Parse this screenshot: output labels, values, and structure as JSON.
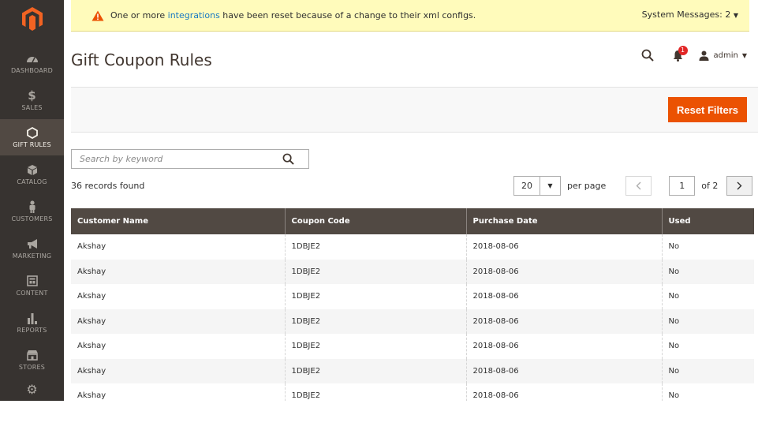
{
  "sidebar": {
    "items": [
      {
        "label": "DASHBOARD",
        "icon": "dashboard-icon",
        "active": false
      },
      {
        "label": "SALES",
        "icon": "dollar-icon",
        "active": false
      },
      {
        "label": "GIFT RULES",
        "icon": "hexagon-icon",
        "active": true
      },
      {
        "label": "CATALOG",
        "icon": "cube-icon",
        "active": false
      },
      {
        "label": "CUSTOMERS",
        "icon": "person-icon",
        "active": false
      },
      {
        "label": "MARKETING",
        "icon": "megaphone-icon",
        "active": false
      },
      {
        "label": "CONTENT",
        "icon": "layout-icon",
        "active": false
      },
      {
        "label": "REPORTS",
        "icon": "bar-chart-icon",
        "active": false
      },
      {
        "label": "STORES",
        "icon": "store-icon",
        "active": false
      },
      {
        "label": "",
        "icon": "gear-icon",
        "active": false
      }
    ]
  },
  "message": {
    "prefix": "One or more ",
    "link": "integrations",
    "suffix": " have been reset because of a change to their xml configs.",
    "system_messages": "System Messages: 2"
  },
  "header": {
    "title": "Gift Coupon Rules",
    "notification_count": "1",
    "user": "admin"
  },
  "actions": {
    "reset_filters": "Reset Filters"
  },
  "search": {
    "placeholder": "Search by keyword"
  },
  "grid": {
    "records_found": "36 records found",
    "per_page_value": "20",
    "per_page_label": "per page",
    "current_page": "1",
    "of_pages": "of 2",
    "columns": [
      "Customer Name",
      "Coupon Code",
      "Purchase Date",
      "Used"
    ],
    "rows": [
      [
        "Akshay",
        "1DBJE2",
        "2018-08-06",
        "No"
      ],
      [
        "Akshay",
        "1DBJE2",
        "2018-08-06",
        "No"
      ],
      [
        "Akshay",
        "1DBJE2",
        "2018-08-06",
        "No"
      ],
      [
        "Akshay",
        "1DBJE2",
        "2018-08-06",
        "No"
      ],
      [
        "Akshay",
        "1DBJE2",
        "2018-08-06",
        "No"
      ],
      [
        "Akshay",
        "1DBJE2",
        "2018-08-06",
        "No"
      ],
      [
        "Akshay",
        "1DBJE2",
        "2018-08-06",
        "No"
      ]
    ]
  },
  "colors": {
    "sidebar_bg": "#373330",
    "sidebar_active": "#514943",
    "accent": "#eb5202",
    "table_header": "#514943",
    "message_bg": "#fffbbb",
    "link": "#1979c3"
  }
}
